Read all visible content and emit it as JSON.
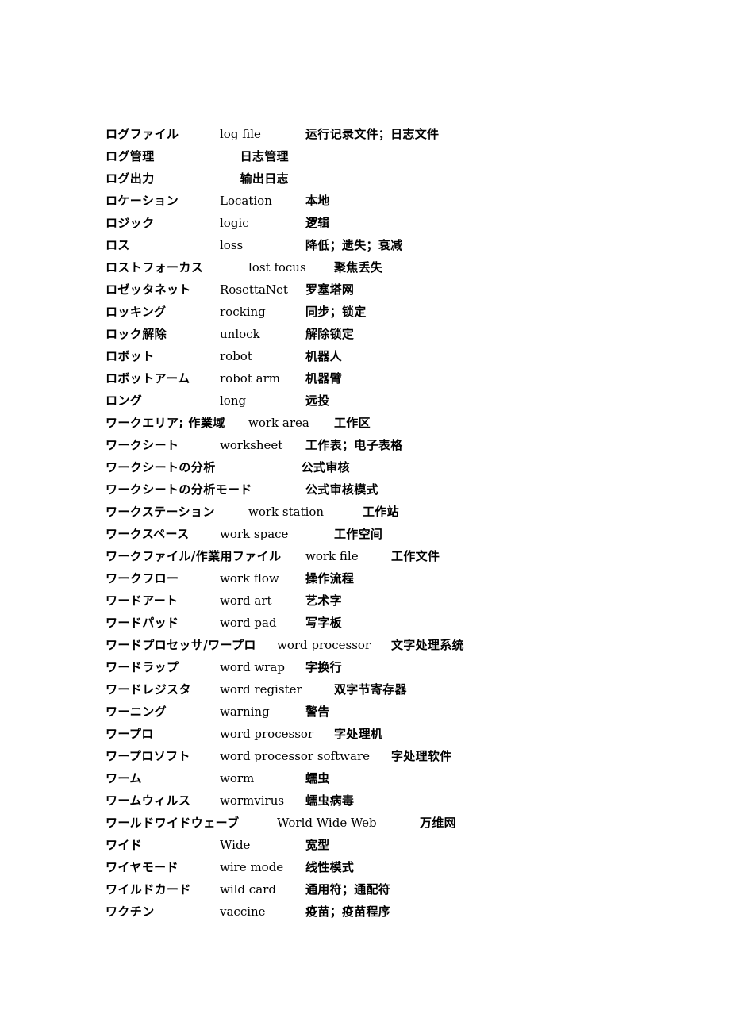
{
  "page": {
    "background_color": "#ffffff",
    "text_color": "#000000",
    "columns": [
      "japanese",
      "english",
      "chinese"
    ]
  },
  "glossary": {
    "entries": [
      {
        "japanese": "ログファイル",
        "english": "log file",
        "chinese": "运行记录文件；日志文件"
      },
      {
        "japanese": "ログ管理",
        "english": "",
        "chinese": "日志管理"
      },
      {
        "japanese": "ログ出力",
        "english": "",
        "chinese": "输出日志"
      },
      {
        "japanese": "ロケーション",
        "english": "Location",
        "chinese": "本地"
      },
      {
        "japanese": "ロジック",
        "english": "logic",
        "chinese": "逻辑"
      },
      {
        "japanese": "ロス",
        "english": "loss",
        "chinese": "降低；遗失；衰减"
      },
      {
        "japanese": "ロストフォーカス",
        "english": "lost focus",
        "chinese": "聚焦丢失"
      },
      {
        "japanese": "ロゼッタネット",
        "english": "RosettaNet",
        "chinese": "罗塞塔网"
      },
      {
        "japanese": "ロッキング",
        "english": "rocking",
        "chinese": "同步；锁定"
      },
      {
        "japanese": "ロック解除",
        "english": "unlock",
        "chinese": "解除锁定"
      },
      {
        "japanese": "ロボット",
        "english": "robot",
        "chinese": "机器人"
      },
      {
        "japanese": "ロボットアーム",
        "english": "robot arm",
        "chinese": "机器臂"
      },
      {
        "japanese": "ロング",
        "english": "long",
        "chinese": "远投"
      },
      {
        "japanese": "ワークエリア; 作業域",
        "english": "work area",
        "chinese": "工作区"
      },
      {
        "japanese": "ワークシート",
        "english": "worksheet",
        "chinese": "工作表；电子表格"
      },
      {
        "japanese": "ワークシートの分析",
        "english": "",
        "chinese": "公式审核"
      },
      {
        "japanese": "ワークシートの分析モード",
        "english": "",
        "chinese": "公式审核模式"
      },
      {
        "japanese": "ワークステーション",
        "english": "work station",
        "chinese": "工作站"
      },
      {
        "japanese": "ワークスペース",
        "english": "work space",
        "chinese": "工作空间"
      },
      {
        "japanese": "ワークファイル/作業用ファイル",
        "english": "work file",
        "chinese": "工作文件"
      },
      {
        "japanese": "ワークフロー",
        "english": "work flow",
        "chinese": "操作流程"
      },
      {
        "japanese": "ワードアート",
        "english": "word art",
        "chinese": "艺术字"
      },
      {
        "japanese": "ワードパッド",
        "english": "word pad",
        "chinese": "写字板"
      },
      {
        "japanese": "ワードプロセッサ/ワープロ",
        "english": "word processor",
        "chinese": "文字处理系统"
      },
      {
        "japanese": "ワードラップ",
        "english": "word wrap",
        "chinese": "字换行"
      },
      {
        "japanese": "ワードレジスタ",
        "english": "word register",
        "chinese": "双字节寄存器"
      },
      {
        "japanese": "ワーニング",
        "english": "warning",
        "chinese": "警告"
      },
      {
        "japanese": "ワープロ",
        "english": "word processor",
        "chinese": "字处理机"
      },
      {
        "japanese": "ワープロソフト",
        "english": "word processor software",
        "chinese": "字处理软件"
      },
      {
        "japanese": "ワーム",
        "english": "worm",
        "chinese": "蠕虫"
      },
      {
        "japanese": "ワームウィルス",
        "english": "wormvirus",
        "chinese": "蠕虫病毒"
      },
      {
        "japanese": "ワールドワイドウェーブ",
        "english": "World Wide Web",
        "chinese": "万维网"
      },
      {
        "japanese": "ワイド",
        "english": "Wide",
        "chinese": "宽型"
      },
      {
        "japanese": "ワイヤモード",
        "english": "wire mode",
        "chinese": "线性模式"
      },
      {
        "japanese": "ワイルドカード",
        "english": "wild card",
        "chinese": "通用符；通配符"
      },
      {
        "japanese": "ワクチン",
        "english": "vaccine",
        "chinese": "疫苗；疫苗程序"
      }
    ]
  }
}
